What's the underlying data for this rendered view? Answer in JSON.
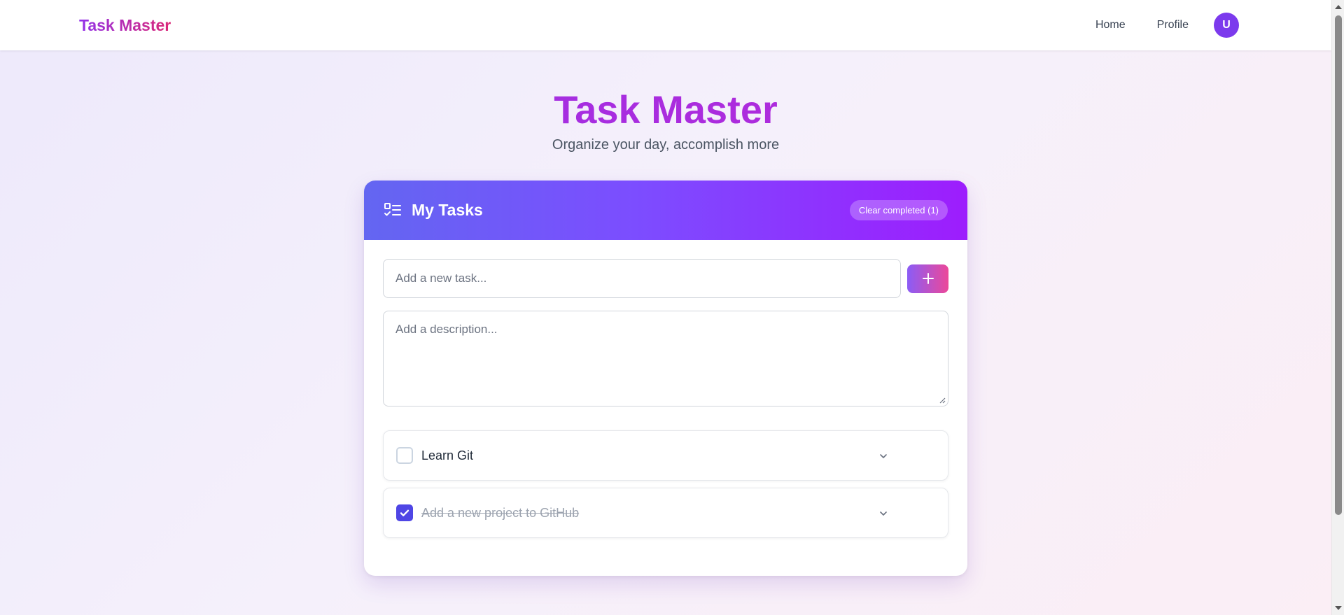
{
  "nav": {
    "brand": "Task Master",
    "links": [
      "Home",
      "Profile"
    ],
    "avatar_letter": "U"
  },
  "hero": {
    "title": "Task Master",
    "subtitle": "Organize your day, accomplish more"
  },
  "card": {
    "title": "My Tasks",
    "clear_label": "Clear completed (1)",
    "task_placeholder": "Add a new task...",
    "description_placeholder": "Add a description...",
    "tasks": [
      {
        "title": "Learn Git",
        "completed": false
      },
      {
        "title": "Add a new project to GitHub",
        "completed": true
      }
    ]
  },
  "colors": {
    "brand_purple": "#7c3aed",
    "header_gradient_start": "#6366f1",
    "header_gradient_end": "#9d1dfd",
    "check_accent": "#4f46e5"
  },
  "icons": [
    "checklist-icon",
    "plus-icon",
    "chevron-down-icon",
    "check-icon"
  ]
}
